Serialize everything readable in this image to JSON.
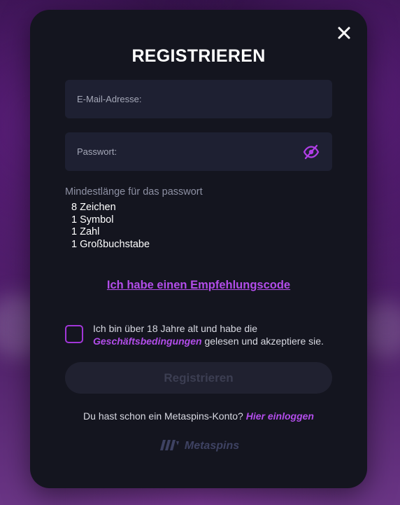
{
  "modal": {
    "title": "REGISTRIEREN",
    "close_icon": "close-icon"
  },
  "form": {
    "email_placeholder": "E-Mail-Adresse:",
    "email_value": "",
    "password_placeholder": "Passwort:",
    "password_value": "",
    "password_toggle_icon": "eye-off-icon"
  },
  "requirements": {
    "title": "Mindestlänge für das passwort",
    "items": [
      "8 Zeichen",
      "1 Symbol",
      "1 Zahl",
      "1 Großbuchstabe"
    ]
  },
  "referral": {
    "link_label": "Ich habe einen Empfehlungscode"
  },
  "terms": {
    "text_before": "Ich bin über 18 Jahre alt und habe die ",
    "link_label": "Geschäftsbedingungen",
    "text_after": " gelesen und akzeptiere sie.",
    "checked": false
  },
  "register": {
    "button_label": "Registrieren",
    "enabled": false
  },
  "login": {
    "prompt": "Du hast schon ein Metaspins-Konto?",
    "link_label": "Hier einloggen"
  },
  "brand": {
    "name": "Metaspins",
    "logo_icon": "metaspins-logo-icon"
  },
  "colors": {
    "accent": "#b24dea",
    "modal_bg": "#14151f",
    "input_bg": "#1e2032",
    "button_disabled_bg": "#202130"
  }
}
